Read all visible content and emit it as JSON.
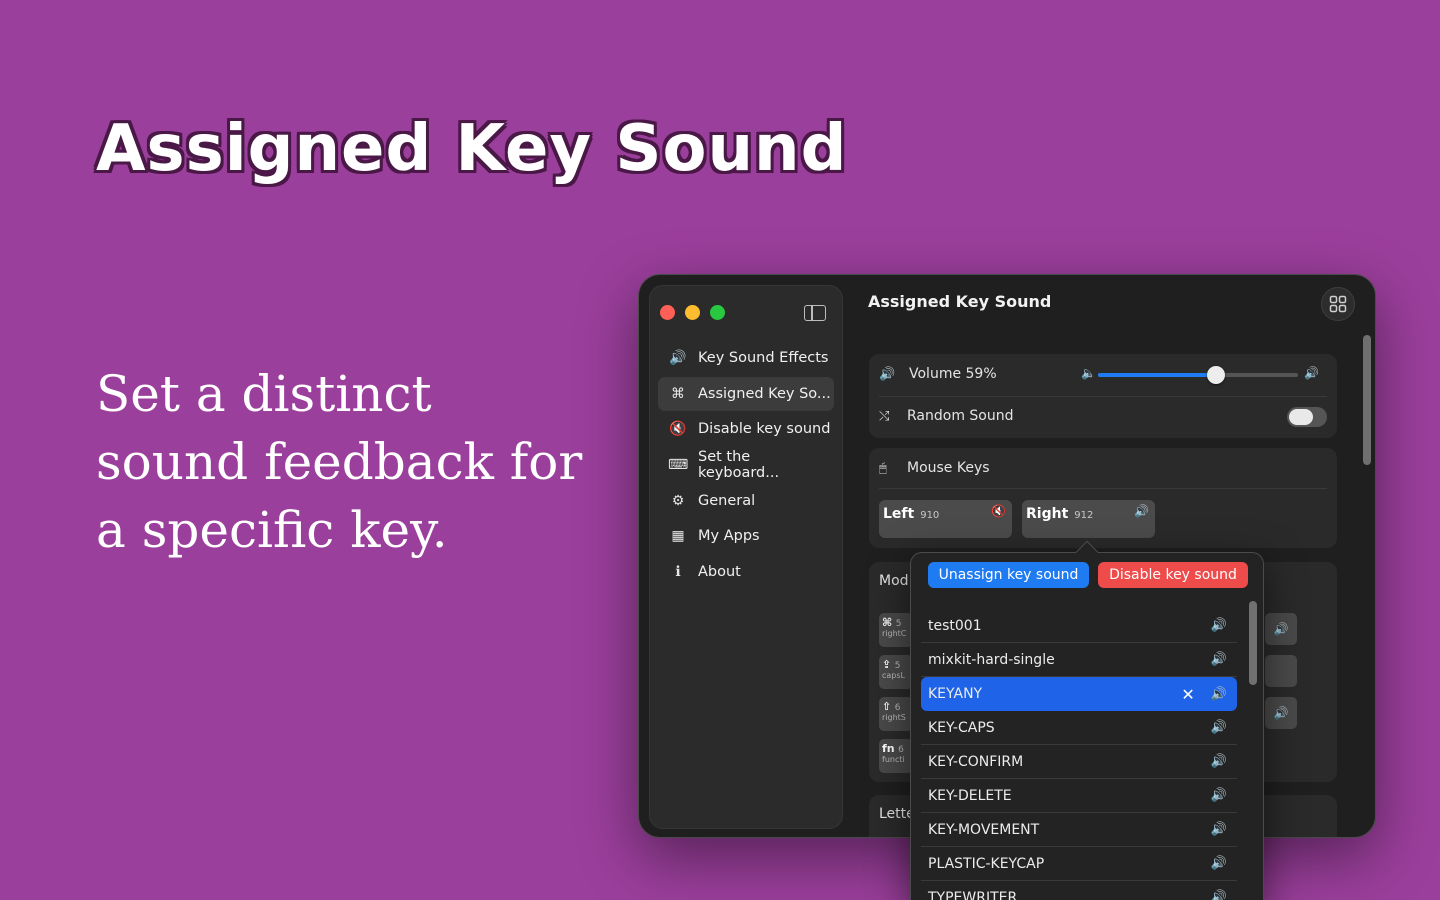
{
  "hero": {
    "title": "Assigned Key Sound",
    "subtitle": "Set a distinct sound feedback for a specific key."
  },
  "window": {
    "title": "Assigned Key Sound",
    "sidebar": [
      {
        "icon": "speaker-icon",
        "glyph": "🔊",
        "label": "Key Sound Effects"
      },
      {
        "icon": "command-icon",
        "glyph": "⌘",
        "label": "Assigned Key So..."
      },
      {
        "icon": "mute-icon",
        "glyph": "🔇",
        "label": "Disable key sound"
      },
      {
        "icon": "keyboard-icon",
        "glyph": "⌨",
        "label": "Set the keyboard..."
      },
      {
        "icon": "gear-icon",
        "glyph": "⚙",
        "label": "General"
      },
      {
        "icon": "apps-icon",
        "glyph": "▦",
        "label": "My Apps"
      },
      {
        "icon": "info-icon",
        "glyph": "ℹ",
        "label": "About"
      }
    ],
    "active_index": 1,
    "volume": {
      "label": "Volume 59%",
      "value_percent": 59
    },
    "random_sound": {
      "label": "Random Sound",
      "enabled": false
    },
    "mouse_keys": {
      "label": "Mouse Keys",
      "left": {
        "name": "Left",
        "code": "910",
        "muted": true
      },
      "right": {
        "name": "Right",
        "code": "912",
        "muted": false
      }
    },
    "modifier_section": {
      "label": "Mod"
    },
    "modifier_keys": [
      {
        "symbol": "⌘",
        "code": "5",
        "sub": "rightC"
      },
      {
        "symbol": "⇪",
        "code": "5",
        "sub": "capsL"
      },
      {
        "symbol": "⇧",
        "code": "6",
        "sub": "rightS"
      },
      {
        "symbol": "fn",
        "code": "6",
        "sub": "functi"
      }
    ],
    "letter_section": {
      "label": "Lette"
    }
  },
  "popover": {
    "unassign_label": "Unassign key sound",
    "disable_label": "Disable key sound",
    "sounds": [
      "test001",
      "mixkit-hard-single",
      "KEYANY",
      "KEY-CAPS",
      "KEY-CONFIRM",
      "KEY-DELETE",
      "KEY-MOVEMENT",
      "PLASTIC-KEYCAP",
      "TYPEWRITER"
    ],
    "selected_index": 2
  },
  "colors": {
    "background": "#9b3f9c",
    "accent": "#1f7bf2",
    "danger": "#ee4b4b"
  }
}
